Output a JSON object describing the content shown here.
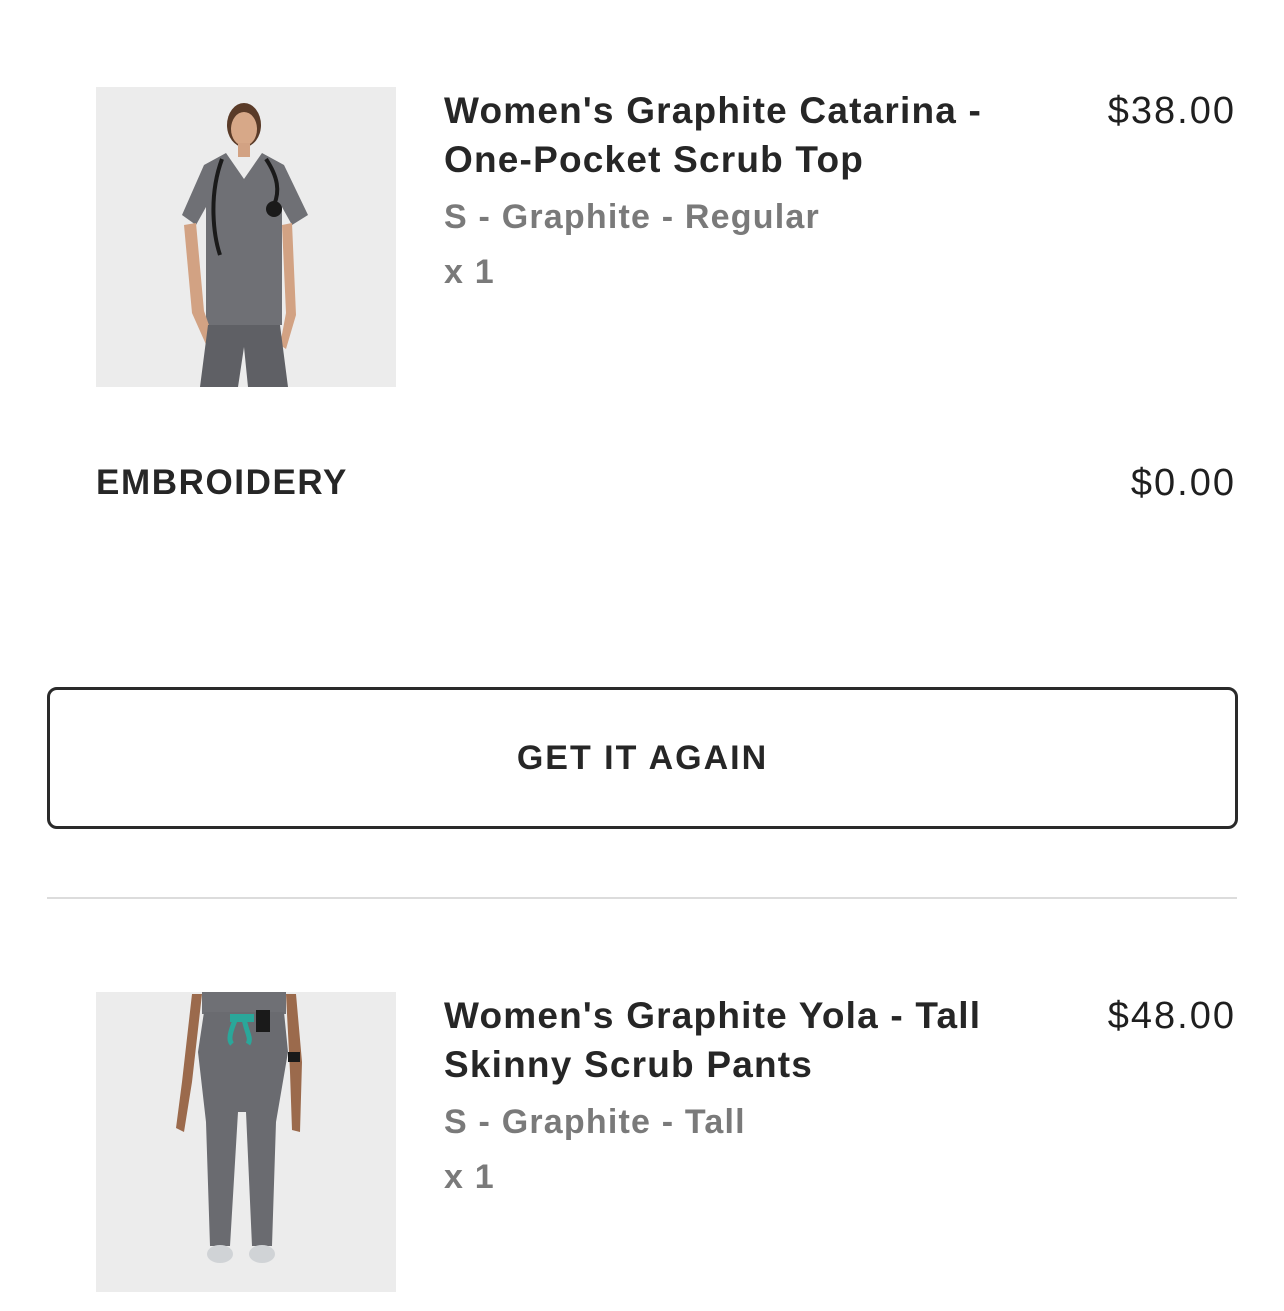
{
  "order_items": [
    {
      "name": "Women's Graphite Catarina - One-Pocket Scrub Top",
      "variant": "S - Graphite - Regular",
      "quantity": "x 1",
      "price": "$38.00",
      "image_icon": "scrub-top-product-photo"
    },
    {
      "name": "Women's Graphite Yola - Tall Skinny Scrub Pants",
      "variant": "S - Graphite - Tall",
      "quantity": "x 1",
      "price": "$48.00",
      "image_icon": "scrub-pants-product-photo"
    }
  ],
  "addon": {
    "label": "EMBROIDERY",
    "price": "$0.00"
  },
  "actions": {
    "get_it_again_label": "GET IT AGAIN"
  },
  "colors": {
    "text": "#262626",
    "muted": "#7a7a7a",
    "border": "#2a2a2a",
    "divider": "#dcdcdc",
    "graphite": "#6f7075"
  }
}
